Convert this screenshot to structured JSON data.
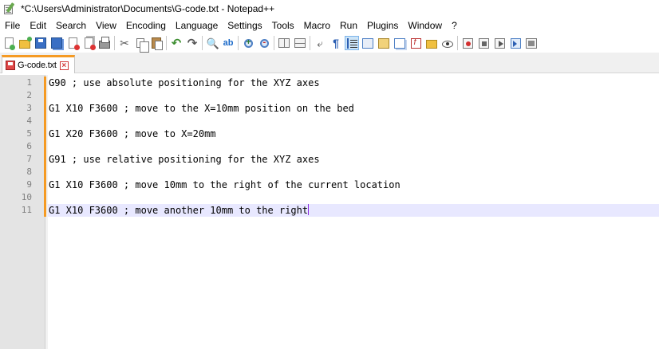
{
  "window": {
    "title": "*C:\\Users\\Administrator\\Documents\\G-code.txt - Notepad++"
  },
  "menu": [
    "File",
    "Edit",
    "Search",
    "View",
    "Encoding",
    "Language",
    "Settings",
    "Tools",
    "Macro",
    "Run",
    "Plugins",
    "Window",
    "?"
  ],
  "toolbar": {
    "icons": [
      "new-file-icon",
      "open-file-icon",
      "save-icon",
      "save-all-icon",
      "close-icon",
      "close-all-icon",
      "print-icon",
      "cut-icon",
      "copy-icon",
      "paste-icon",
      "undo-icon",
      "redo-icon",
      "find-icon",
      "replace-icon",
      "zoom-in-icon",
      "zoom-out-icon",
      "sync-vertical-icon",
      "sync-horizontal-icon",
      "word-wrap-icon",
      "show-all-characters-icon",
      "indent-guide-icon",
      "user-defined-language-icon",
      "document-map-icon",
      "document-list-icon",
      "function-list-icon",
      "folder-workspace-icon",
      "monitoring-icon",
      "record-macro-icon",
      "stop-recording-icon",
      "playback-macro-icon",
      "run-macro-multiple-icon",
      "save-macro-icon"
    ],
    "cut_glyph": "✂",
    "undo_glyph": "↶",
    "redo_glyph": "↷",
    "find_glyph": "🔍",
    "replace_glyph": "ab",
    "wrap_glyph": "⤶",
    "allchars_glyph": "¶"
  },
  "tab": {
    "label": "G-code.txt",
    "close_glyph": "×"
  },
  "editor": {
    "lines": [
      {
        "no": "1",
        "text": "G90 ; use absolute positioning for the XYZ axes"
      },
      {
        "no": "2",
        "text": ""
      },
      {
        "no": "3",
        "text": "G1 X10 F3600 ; move to the X=10mm position on the bed"
      },
      {
        "no": "4",
        "text": ""
      },
      {
        "no": "5",
        "text": "G1 X20 F3600 ; move to X=20mm"
      },
      {
        "no": "6",
        "text": ""
      },
      {
        "no": "7",
        "text": "G91 ; use relative positioning for the XYZ axes"
      },
      {
        "no": "8",
        "text": ""
      },
      {
        "no": "9",
        "text": "G1 X10 F3600 ; move 10mm to the right of the current location"
      },
      {
        "no": "10",
        "text": ""
      },
      {
        "no": "11",
        "text": "G1 X10 F3600 ; move another 10mm to the right"
      }
    ],
    "current_line": 11
  }
}
